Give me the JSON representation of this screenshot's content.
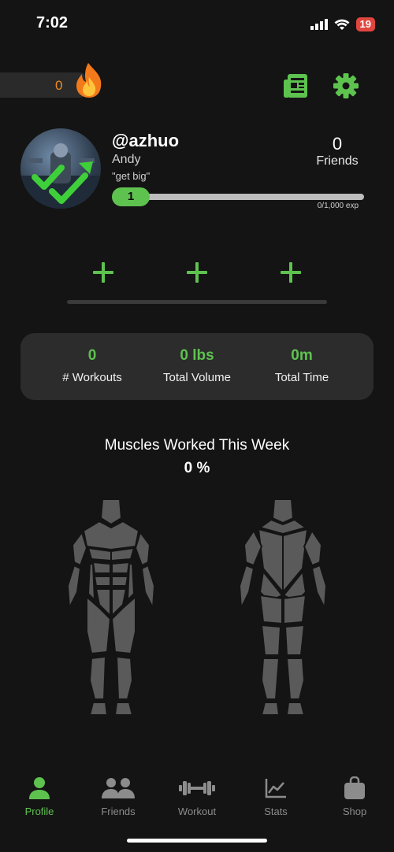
{
  "status": {
    "time": "7:02",
    "battery": "19"
  },
  "streak": {
    "count": "0"
  },
  "profile": {
    "username": "@azhuo",
    "name": "Andy",
    "bio": "\"get big\"",
    "friends_count": "0",
    "friends_label": "Friends",
    "level": "1",
    "exp_text": "0/1,000 exp",
    "exp_progress": 0
  },
  "stats": [
    {
      "value": "0",
      "label": "# Workouts"
    },
    {
      "value": "0 lbs",
      "label": "Total Volume"
    },
    {
      "value": "0m",
      "label": "Total Time"
    }
  ],
  "muscles": {
    "title": "Muscles Worked This Week",
    "percent": "0 %"
  },
  "tabs": [
    {
      "label": "Profile",
      "icon": "person-icon",
      "active": true
    },
    {
      "label": "Friends",
      "icon": "people-icon",
      "active": false
    },
    {
      "label": "Workout",
      "icon": "dumbbell-icon",
      "active": false
    },
    {
      "label": "Stats",
      "icon": "chart-icon",
      "active": false
    },
    {
      "label": "Shop",
      "icon": "bag-icon",
      "active": false
    }
  ],
  "colors": {
    "accent": "#5ec24f",
    "streak": "#f08a24",
    "background": "#141414",
    "card": "#2c2c2c"
  }
}
